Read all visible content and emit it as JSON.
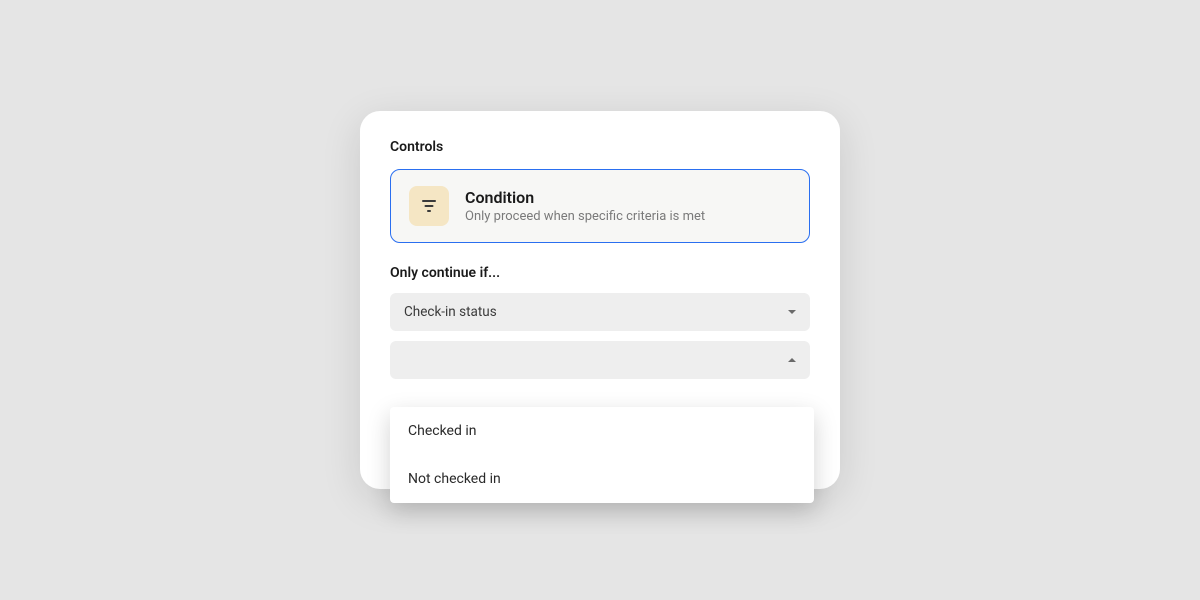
{
  "card": {
    "title": "Controls"
  },
  "condition": {
    "title": "Condition",
    "description": "Only proceed when specific criteria is met"
  },
  "section": {
    "label": "Only continue if..."
  },
  "select_field": {
    "value": "Check-in status"
  },
  "select_value": {
    "value": ""
  },
  "dropdown": {
    "options": [
      "Checked in",
      "Not checked in"
    ]
  }
}
